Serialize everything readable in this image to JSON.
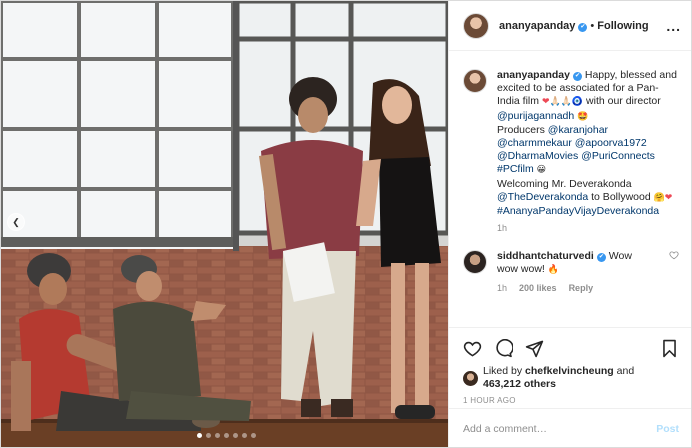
{
  "author": {
    "username": "ananyapanday",
    "follow_state": "Following",
    "verified_mark": "✔",
    "more_glyph": "..."
  },
  "caption": {
    "username": "ananyapanday",
    "part1": "Happy, blessed and excited to be associated for a Pan-India film ",
    "emojis1": "❤🙏🏻🙏🏻🧿",
    "part2": " with our director ",
    "director_tag": "@purijagannadh",
    "emojis2": " 🤩",
    "producers_label": "Producers ",
    "producer1": "@karanjohar",
    "producer2": "@charmmekaur",
    "producer3": "@apoorva1972",
    "producer4": "@DharmaMovies",
    "producer5": "@PuriConnects",
    "hashtag1": "#PCfilm",
    "emojis3": " 😀",
    "welcome_text": "Welcoming Mr. Deverakonda ",
    "deverakonda_tag": "@TheDeverakonda",
    "bollywood_text": " to Bollywood ",
    "emojis4": "🤗❤",
    "hashtag2": "#AnanyaPandayVijayDeverakonda",
    "time": "1h"
  },
  "comment": {
    "username": "siddhantchaturvedi",
    "text": "Wow wow wow! ",
    "emoji": "🔥",
    "time": "1h",
    "likes": "200 likes",
    "reply": "Reply"
  },
  "likes": {
    "prefix": "Liked by ",
    "user": "chefkelvincheung",
    "middle": " and",
    "count": "463,212",
    "suffix": " others"
  },
  "timestamp": "1 HOUR AGO",
  "add_comment": {
    "placeholder": "Add a comment…",
    "post_label": "Post"
  },
  "icons": [
    "heart-icon",
    "comment-icon",
    "share-icon",
    "bookmark-icon",
    "carousel-prev-icon"
  ],
  "colors": {
    "link": "#00376b",
    "verified": "#3897f0",
    "heart": "#ed4956",
    "post_disabled": "#b2dffc"
  }
}
